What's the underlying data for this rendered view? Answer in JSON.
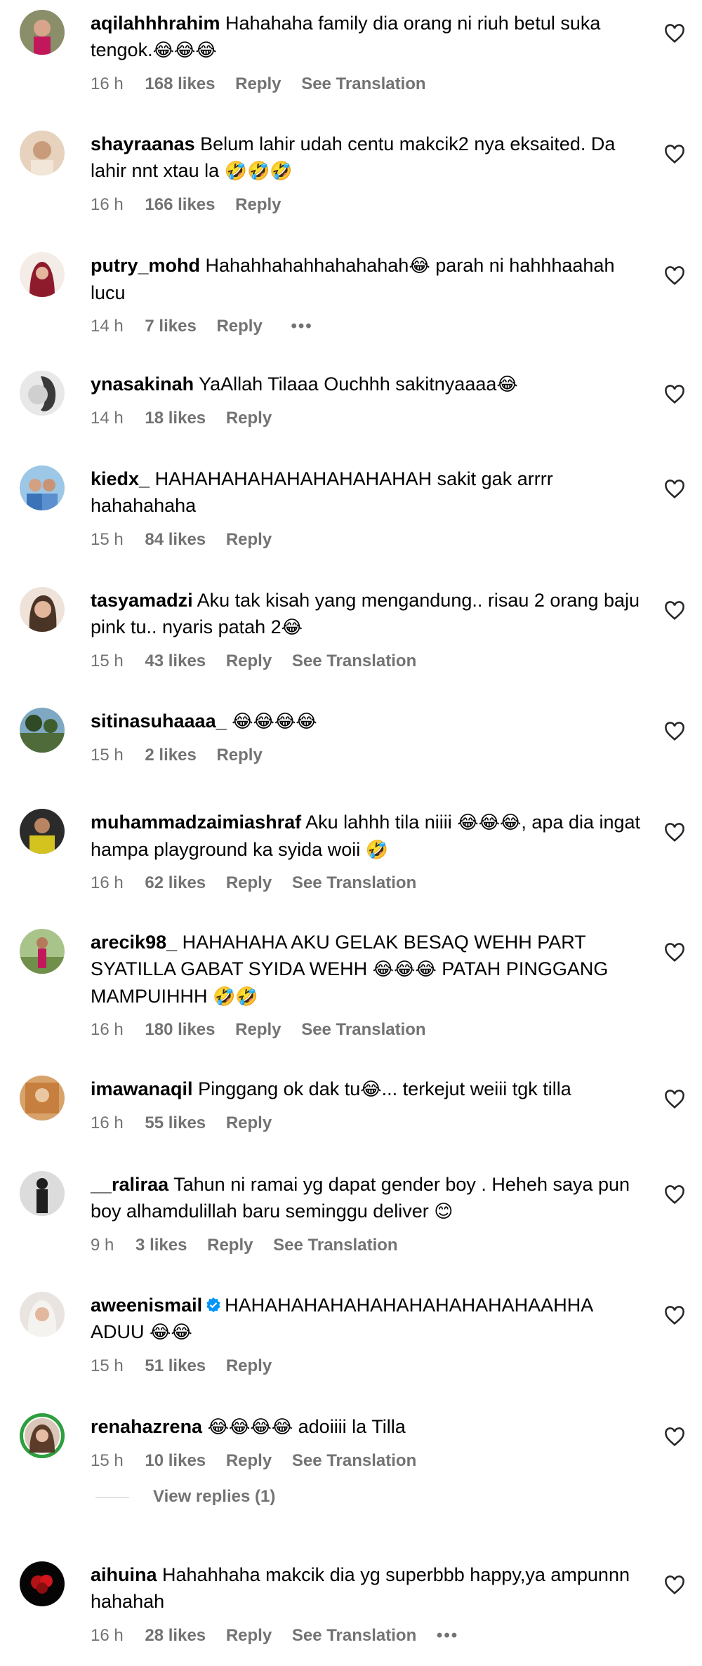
{
  "comments": [
    {
      "username": "aqilahhhrahim",
      "text": "Hahahaha family dia orang ni riuh betul suka tengok.",
      "emoji": "😂😂😂",
      "time": "16 h",
      "likes": "168 likes",
      "reply": "Reply",
      "translation": "See Translation"
    },
    {
      "username": "shayraanas",
      "text": "Belum lahir udah centu makcik2 nya eksaited. Da lahir nnt xtau la",
      "emoji": "🤣🤣🤣",
      "time": "16 h",
      "likes": "166 likes",
      "reply": "Reply"
    },
    {
      "username": "putry_mohd",
      "text": "Hahahhahahhahahahah",
      "emoji": "😂",
      "text2": "parah ni hahhhaahah lucu",
      "time": "14 h",
      "likes": "7 likes",
      "reply": "Reply",
      "more": "•••"
    },
    {
      "username": "ynasakinah",
      "text": "YaAllah Tilaaa Ouchhh sakitnyaaaa",
      "emoji": "😂",
      "time": "14 h",
      "likes": "18 likes",
      "reply": "Reply"
    },
    {
      "username": "kiedx_",
      "text": "HAHAHAHAHAHAHAHAHAHAH sakit gak arrrr hahahahaha",
      "time": "15 h",
      "likes": "84 likes",
      "reply": "Reply"
    },
    {
      "username": "tasyamadzi",
      "text": "Aku tak kisah yang mengandung.. risau 2 orang baju pink tu.. nyaris patah 2",
      "emoji": "😂",
      "time": "15 h",
      "likes": "43 likes",
      "reply": "Reply",
      "translation": "See Translation"
    },
    {
      "username": "sitinasuhaaaa_",
      "text": "",
      "emoji": "😂😂😂😂",
      "time": "15 h",
      "likes": "2 likes",
      "reply": "Reply"
    },
    {
      "username": "muhammadzaimiashraf",
      "text": "Aku lahhh tila niiii",
      "emoji": "😂😂😂",
      "text2": ", apa dia ingat hampa playground ka syida woii",
      "emoji2": "🤣",
      "time": "16 h",
      "likes": "62 likes",
      "reply": "Reply",
      "translation": "See Translation"
    },
    {
      "username": "arecik98_",
      "text": "HAHAHAHA AKU GELAK BESAQ WEHH PART SYATILLA GABAT SYIDA WEHH",
      "emoji": "😂😂😂",
      "text2": "PATAH PINGGANG MAMPUIHHH",
      "emoji2": "🤣🤣",
      "time": "16 h",
      "likes": "180 likes",
      "reply": "Reply",
      "translation": "See Translation"
    },
    {
      "username": "imawanaqil",
      "text": "Pinggang ok dak tu",
      "emoji": "😂",
      "text2": "... terkejut weiii tgk tilla",
      "time": "16 h",
      "likes": "55 likes",
      "reply": "Reply"
    },
    {
      "username": "__raliraa",
      "text": "Tahun ni ramai yg dapat gender boy . Heheh saya pun boy alhamdulillah baru seminggu deliver",
      "emoji": "😊",
      "time": "9 h",
      "likes": "3 likes",
      "reply": "Reply",
      "translation": "See Translation"
    },
    {
      "username": "aweenismail",
      "text": "HAHAHAHAHAHAHAHAHAHAHAHAAHHA ADUU",
      "emoji": "😂😂",
      "time": "15 h",
      "likes": "51 likes",
      "reply": "Reply",
      "verified": true
    },
    {
      "username": "renahazrena",
      "text": "",
      "emoji": "😂😂😂😂",
      "text2": "adoiiii la Tilla",
      "time": "15 h",
      "likes": "10 likes",
      "reply": "Reply",
      "translation": "See Translation"
    },
    {
      "username": "aihuina",
      "text": "Hahahhaha makcik dia yg superbbb happy,ya ampunnn hahahah",
      "time": "16 h",
      "likes": "28 likes",
      "reply": "Reply",
      "translation": "See Translation",
      "more": "•••"
    }
  ],
  "view_replies": "View replies (1)",
  "colors": {
    "text": "#000000",
    "meta": "#737373",
    "verified": "#0095f6"
  }
}
